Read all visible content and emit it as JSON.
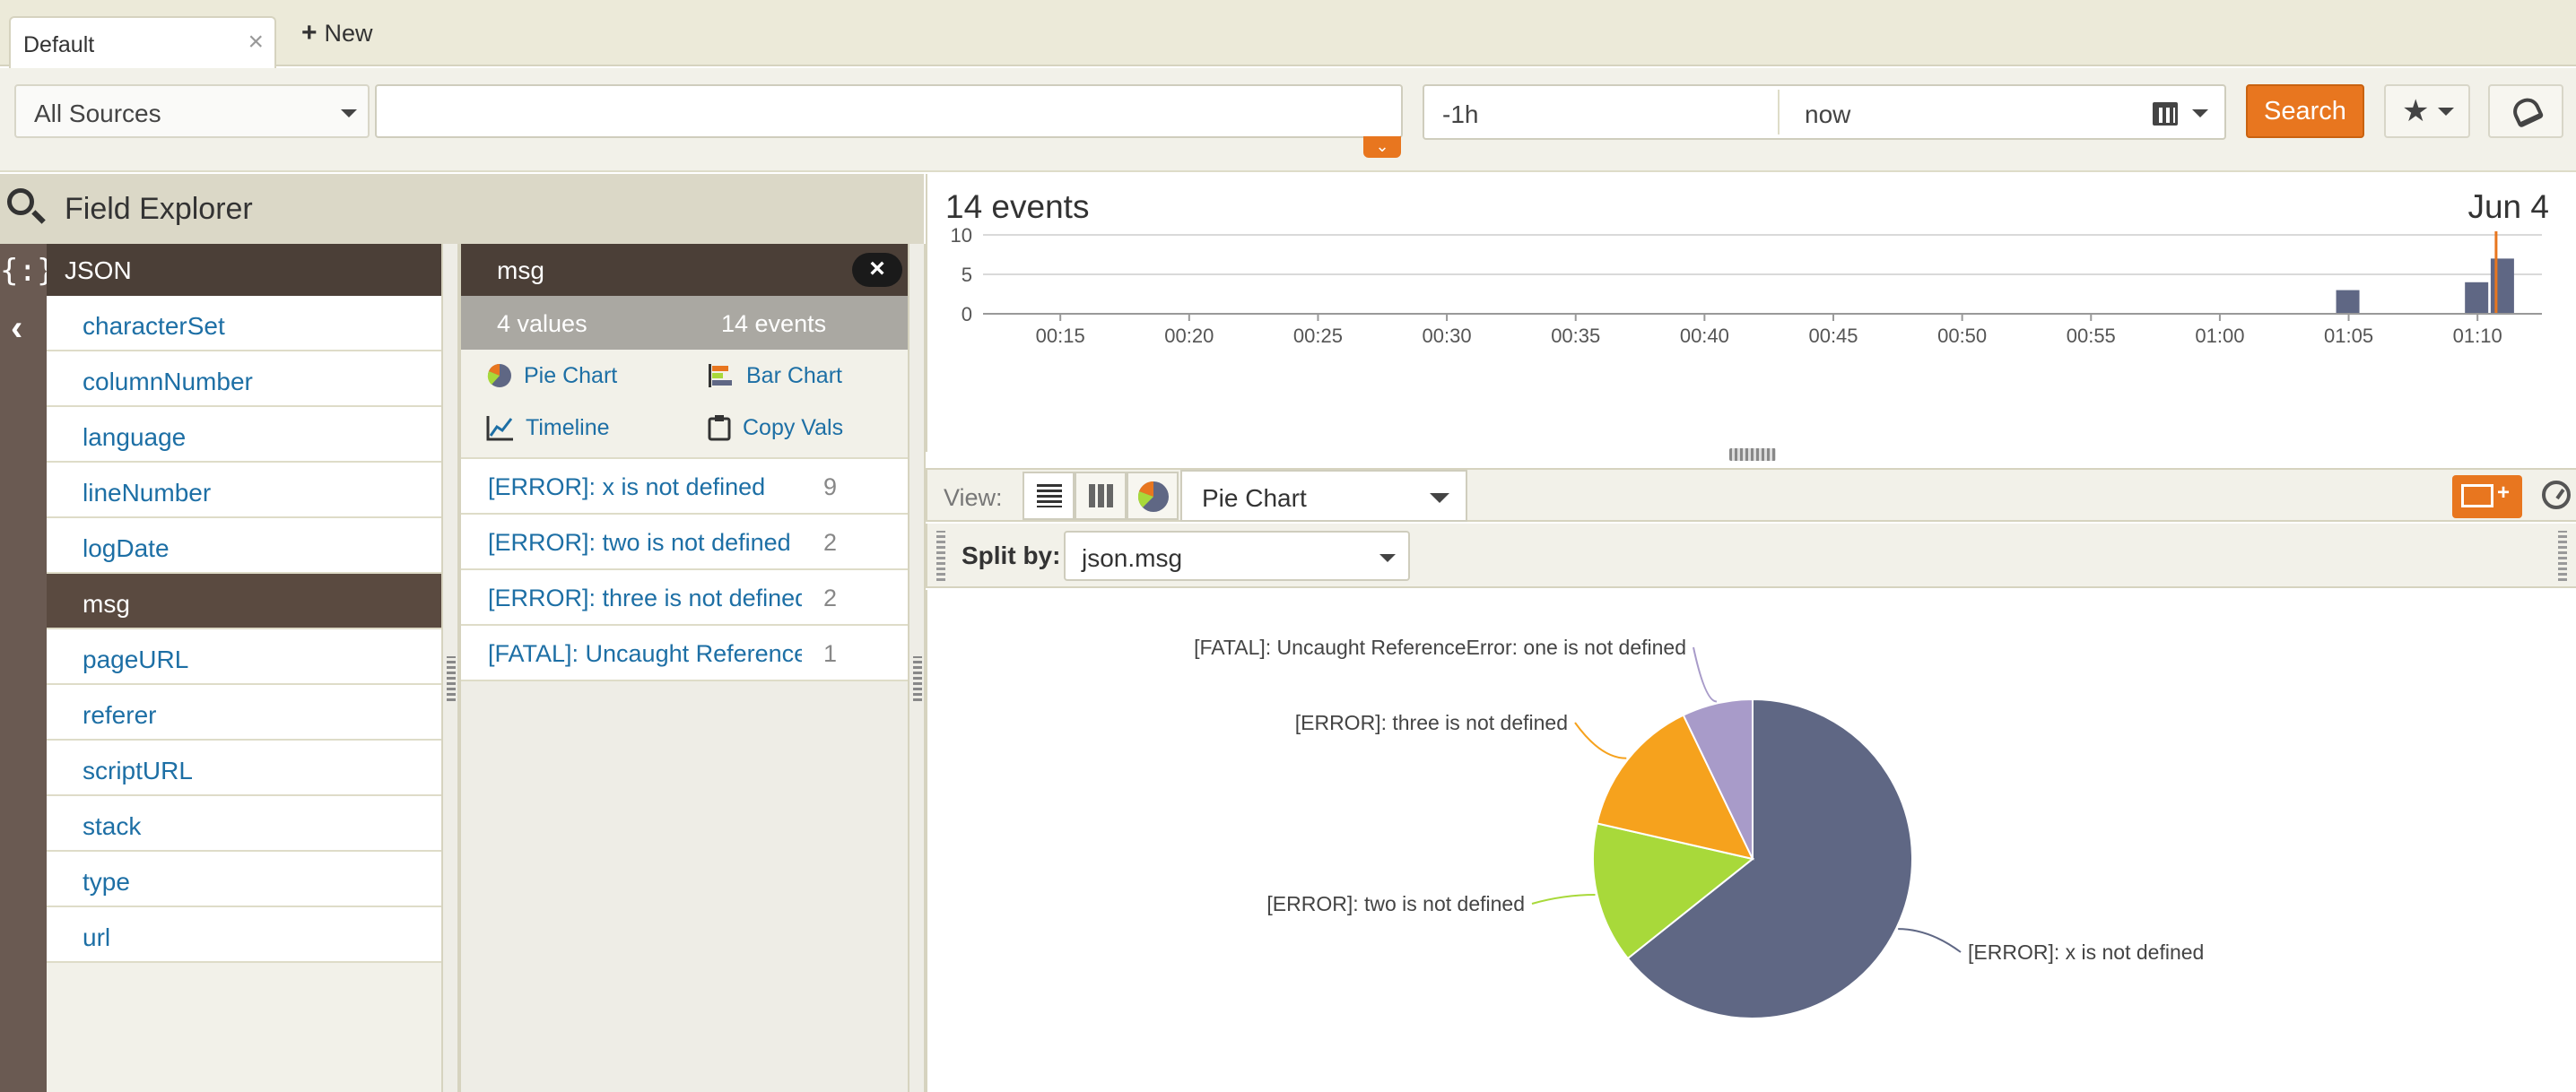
{
  "tabs": [
    {
      "label": "Default",
      "close": "×"
    }
  ],
  "new_tab_label": "New",
  "search": {
    "sources_label": "All Sources",
    "query_value": "",
    "time_from": "-1h",
    "time_to": "now",
    "search_button": "Search"
  },
  "field_explorer": {
    "title": "Field Explorer",
    "group_label": "JSON",
    "fields": [
      "characterSet",
      "columnNumber",
      "language",
      "lineNumber",
      "logDate",
      "msg",
      "pageURL",
      "referer",
      "scriptURL",
      "stack",
      "type",
      "url"
    ],
    "selected_field": "msg"
  },
  "values_panel": {
    "field": "msg",
    "close": "×",
    "values_count": "4 values",
    "events_count": "14 events",
    "actions": {
      "pie": "Pie Chart",
      "bar": "Bar Chart",
      "timeline": "Timeline",
      "copy": "Copy Vals"
    },
    "rows": [
      {
        "text": "[ERROR]: x is not defined",
        "count": "9"
      },
      {
        "text": "[ERROR]: two is not defined",
        "count": "2"
      },
      {
        "text": "[ERROR]: three is not defined",
        "count": "2"
      },
      {
        "text": "[FATAL]: Uncaught ReferenceError: one is not defined",
        "count": "1"
      }
    ]
  },
  "histogram": {
    "events_label": "14 events",
    "date_label": "Jun 4"
  },
  "view_bar": {
    "label": "View:",
    "selected_viz": "Pie Chart"
  },
  "split": {
    "label": "Split by:",
    "value": "json.msg"
  },
  "colors": {
    "accent": "#e8761f",
    "header_dark": "#4b3f37",
    "link": "#1d6fa5",
    "bar": "#5f6784"
  },
  "chart_data": [
    {
      "type": "bar",
      "x": [
        "00:15",
        "00:20",
        "00:25",
        "00:30",
        "00:35",
        "00:40",
        "00:45",
        "00:50",
        "00:55",
        "01:00",
        "01:05",
        "01:10"
      ],
      "ylim": [
        0,
        10
      ],
      "yticks": [
        "10",
        "5",
        "0"
      ],
      "bars": [
        {
          "x": "01:05",
          "value": 3
        },
        {
          "x": "01:10",
          "value": 4
        },
        {
          "x": "01:11",
          "value": 7
        }
      ]
    },
    {
      "type": "pie",
      "slices": [
        {
          "label": "[ERROR]: x is not defined",
          "value": 9,
          "color": "#5f6784"
        },
        {
          "label": "[ERROR]: two is not defined",
          "value": 2,
          "color": "#a8d93a"
        },
        {
          "label": "[ERROR]: three is not defined",
          "value": 2,
          "color": "#f6a21d"
        },
        {
          "label": "[FATAL]: Uncaught ReferenceError: one is not defined",
          "value": 1,
          "color": "#a89bc9"
        }
      ]
    }
  ]
}
